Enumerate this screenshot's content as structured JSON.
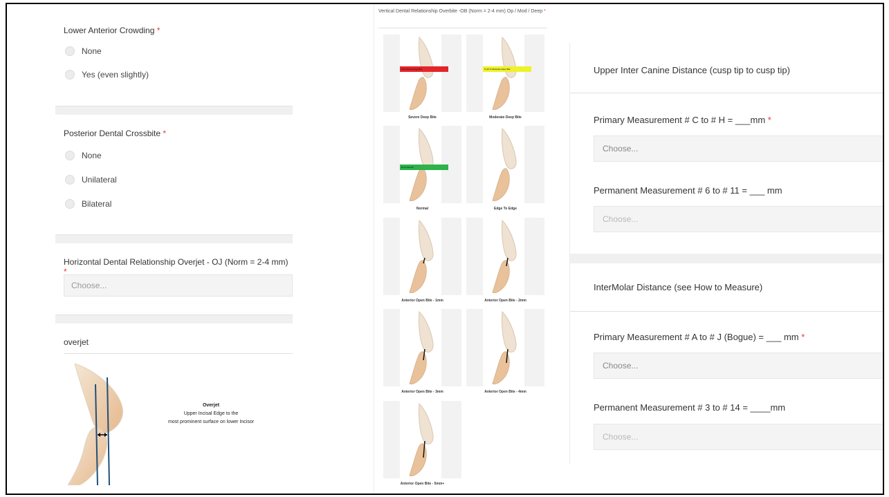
{
  "left": {
    "lower_crowding": {
      "title": "Lower Anterior Crowding",
      "options": [
        "None",
        "Yes (even slightly)"
      ]
    },
    "posterior_crossbite": {
      "title": "Posterior Dental Crossbite",
      "options": [
        "None",
        "Unilateral",
        "Bilateral"
      ]
    },
    "overjet_question": {
      "title": "Horizontal Dental Relationship Overjet - OJ (Norm = 2-4 mm)",
      "placeholder": "Choose..."
    },
    "overjet_info": {
      "title": "overjet",
      "caption_title": "Overjet",
      "caption_line1": "Upper Incisal Edge to the",
      "caption_line2": "most prominent surface on lower Incisor"
    },
    "required_mark": "*"
  },
  "middle": {
    "title": "Vertical Dental Relationship Overbite -OB (Norm = 2-4 mm) Op / Mod / Deep",
    "required_mark": "*",
    "tiles": [
      {
        "caption": "Severe Deep Bite",
        "band_label": "15% Severe Deep Bite",
        "band_color": "#e3262b"
      },
      {
        "caption": "Moderate Deep Bite",
        "band_label": "5~40 % Moderate Deep Bite",
        "band_color": "#eef22a"
      },
      {
        "caption": "Normal",
        "band_label": "20 % Normal",
        "band_color": "#2eb24b"
      },
      {
        "caption": "Edge To Edge"
      },
      {
        "caption": "Anterior Open Bite - 1mm"
      },
      {
        "caption": "Anterior Open Bite - 2mm"
      },
      {
        "caption": "Anterior Open Bite - 3mm"
      },
      {
        "caption": "Anterior Open Bite - 4mm"
      },
      {
        "caption": "Anterior Open Bite - 5mm+"
      }
    ]
  },
  "right": {
    "canine_heading": "Upper Inter Canine Distance (cusp tip to cusp tip)",
    "canine_primary_label": "Primary Measurement # C to # H = ___mm",
    "canine_primary_placeholder": "Choose...",
    "canine_permanent_label": "Permanent Measurement # 6 to # 11 = ___ mm",
    "canine_permanent_placeholder": "Choose...",
    "molar_heading": "InterMolar Distance (see How to Measure)",
    "molar_primary_label": "Primary Measurement # A to # J (Bogue) = ___ mm",
    "molar_primary_placeholder": "Choose...",
    "molar_permanent_label": "Permanent Measurement # 3 to # 14 = ____mm",
    "molar_permanent_placeholder": "Choose...",
    "required_mark": "*"
  },
  "colors": {
    "required": "#e03b3b",
    "overjet_lines": "#1f4e79"
  }
}
